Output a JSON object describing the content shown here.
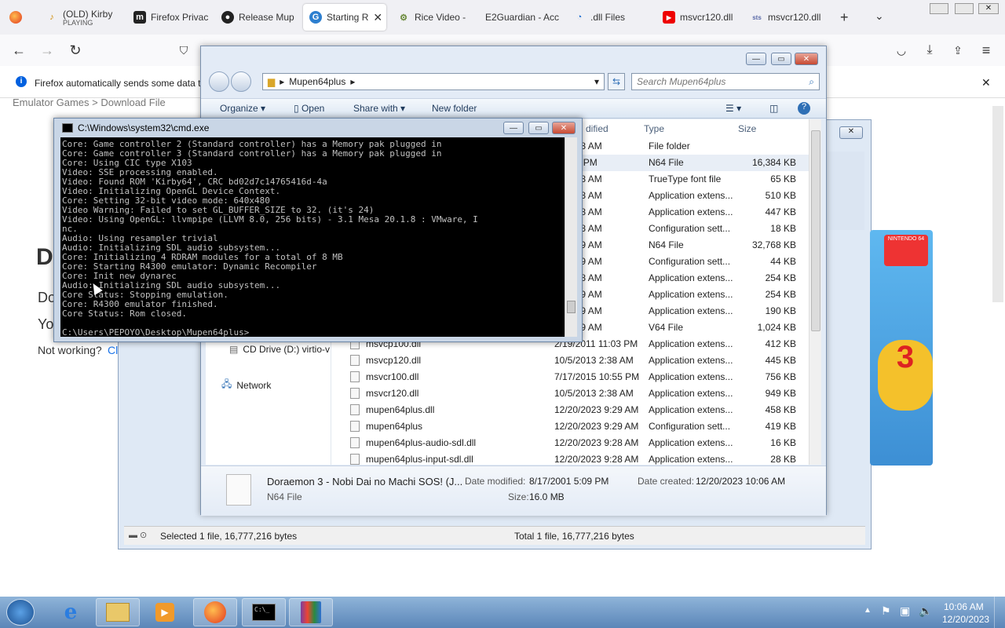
{
  "browser": {
    "tabs": [
      {
        "label": "(OLD) Kirby",
        "sub": "PLAYING",
        "icon": "music-note-icon"
      },
      {
        "label": "Firefox Privac",
        "icon": "m-icon"
      },
      {
        "label": "Release Mup",
        "icon": "github-icon"
      },
      {
        "label": "Starting R",
        "icon": "g-icon",
        "active": true
      },
      {
        "label": "Rice Video -",
        "icon": "gear-icon"
      },
      {
        "label": "E2Guardian - Acc",
        "icon": "page-icon"
      },
      {
        "label": ".dll Files",
        "icon": "dll-icon"
      },
      {
        "label": "msvcr120.dll",
        "icon": "youtube-icon"
      },
      {
        "label": "msvcr120.dll",
        "icon": "sts-icon"
      }
    ],
    "notification": "Firefox automatically sends some data to",
    "breadcrumb": "Emulator Games > Download File",
    "page_heading": "D",
    "page_lines": [
      "Do",
      "Yo"
    ],
    "not_working": "Not working?",
    "not_working_link": "Cl"
  },
  "explorer": {
    "path": "Mupen64plus",
    "search_placeholder": "Search Mupen64plus",
    "toolbar": [
      "Organize",
      "Open",
      "Share with",
      "New folder"
    ],
    "columns": {
      "modified": "dified",
      "type": "Type",
      "size": "Size"
    },
    "nav_items": [
      {
        "label": "CD Drive (D:) virtio-v",
        "icon": "cd-drive-icon"
      },
      {
        "label": "Network",
        "icon": "network-icon"
      }
    ],
    "rows": [
      {
        "name": "",
        "date": "23 9:28 AM",
        "type": "File folder",
        "size": ""
      },
      {
        "name": "",
        "date": "1 5:09 PM",
        "type": "N64 File",
        "size": "16,384 KB",
        "selected": true
      },
      {
        "name": "",
        "date": "23 9:28 AM",
        "type": "TrueType font file",
        "size": "65 KB"
      },
      {
        "name": "",
        "date": "23 9:28 AM",
        "type": "Application extens...",
        "size": "510 KB"
      },
      {
        "name": "",
        "date": "23 9:28 AM",
        "type": "Application extens...",
        "size": "447 KB"
      },
      {
        "name": "",
        "date": "23 9:28 AM",
        "type": "Configuration sett...",
        "size": "18 KB"
      },
      {
        "name": "",
        "date": "23 9:29 AM",
        "type": "N64 File",
        "size": "32,768 KB"
      },
      {
        "name": "",
        "date": "23 9:29 AM",
        "type": "Configuration sett...",
        "size": "44 KB"
      },
      {
        "name": "",
        "date": "23 9:28 AM",
        "type": "Application extens...",
        "size": "254 KB"
      },
      {
        "name": "",
        "date": "23 9:29 AM",
        "type": "Application extens...",
        "size": "254 KB"
      },
      {
        "name": "",
        "date": "23 9:29 AM",
        "type": "Application extens...",
        "size": "190 KB"
      },
      {
        "name": "",
        "date": "23 9:29 AM",
        "type": "V64 File",
        "size": "1,024 KB"
      },
      {
        "name": "msvcp100.dll",
        "date": "2/19/2011 11:03 PM",
        "type": "Application extens...",
        "size": "412 KB"
      },
      {
        "name": "msvcp120.dll",
        "date": "10/5/2013 2:38 AM",
        "type": "Application extens...",
        "size": "445 KB"
      },
      {
        "name": "msvcr100.dll",
        "date": "7/17/2015 10:55 PM",
        "type": "Application extens...",
        "size": "756 KB"
      },
      {
        "name": "msvcr120.dll",
        "date": "10/5/2013 2:38 AM",
        "type": "Application extens...",
        "size": "949 KB"
      },
      {
        "name": "mupen64plus.dll",
        "date": "12/20/2023 9:29 AM",
        "type": "Application extens...",
        "size": "458 KB"
      },
      {
        "name": "mupen64plus",
        "date": "12/20/2023 9:29 AM",
        "type": "Configuration sett...",
        "size": "419 KB"
      },
      {
        "name": "mupen64plus-audio-sdl.dll",
        "date": "12/20/2023 9:28 AM",
        "type": "Application extens...",
        "size": "16 KB"
      },
      {
        "name": "mupen64plus-input-sdl.dll",
        "date": "12/20/2023 9:28 AM",
        "type": "Application extens...",
        "size": "28 KB"
      }
    ],
    "details": {
      "filename": "Doraemon 3 - Nobi Dai no Machi SOS! (J...",
      "filetype": "N64 File",
      "date_modified_label": "Date modified:",
      "date_modified": "8/17/2001 5:09 PM",
      "size_label": "Size:",
      "size": "16.0 MB",
      "date_created_label": "Date created:",
      "date_created": "12/20/2023 10:06 AM"
    }
  },
  "statusbar": {
    "selected": "Selected 1 file, 16,777,216 bytes",
    "total": "Total 1 file, 16,777,216 bytes"
  },
  "cmd": {
    "title": "C:\\Windows\\system32\\cmd.exe",
    "lines": [
      "Core: Game controller 2 (Standard controller) has a Memory pak plugged in",
      "Core: Game controller 3 (Standard controller) has a Memory pak plugged in",
      "Core: Using CIC type X103",
      "Video: SSE processing enabled.",
      "Video: Found ROM 'Kirby64', CRC bd02d7c14765416d-4a",
      "Video: Initializing OpenGL Device Context.",
      "Core: Setting 32-bit video mode: 640x480",
      "Video Warning: Failed to set GL_BUFFER_SIZE to 32. (it's 24)",
      "Video: Using OpenGL: llvmpipe (LLVM 8.0, 256 bits) - 3.1 Mesa 20.1.8 : VMware, I",
      "nc.",
      "Audio: Using resampler trivial",
      "Audio: Initializing SDL audio subsystem...",
      "Core: Initializing 4 RDRAM modules for a total of 8 MB",
      "Core: Starting R4300 emulator: Dynamic Recompiler",
      "Core: Init new dynarec",
      "Audio: Initializing SDL audio subsystem...",
      "Core Status: Stopping emulation.",
      "Core: R4300 emulator finished.",
      "Core Status: Rom closed.",
      "",
      "C:\\Users\\PEPOYO\\Desktop\\Mupen64plus>"
    ]
  },
  "taskbar": {
    "clock_time": "10:06 AM",
    "clock_date": "12/20/2023",
    "apps": [
      "start-orb-icon",
      "internet-explorer-icon",
      "file-explorer-icon",
      "media-player-icon",
      "firefox-icon",
      "cmd-icon",
      "winrar-icon"
    ]
  },
  "boxart": {
    "brand": "NINTENDO 64"
  }
}
